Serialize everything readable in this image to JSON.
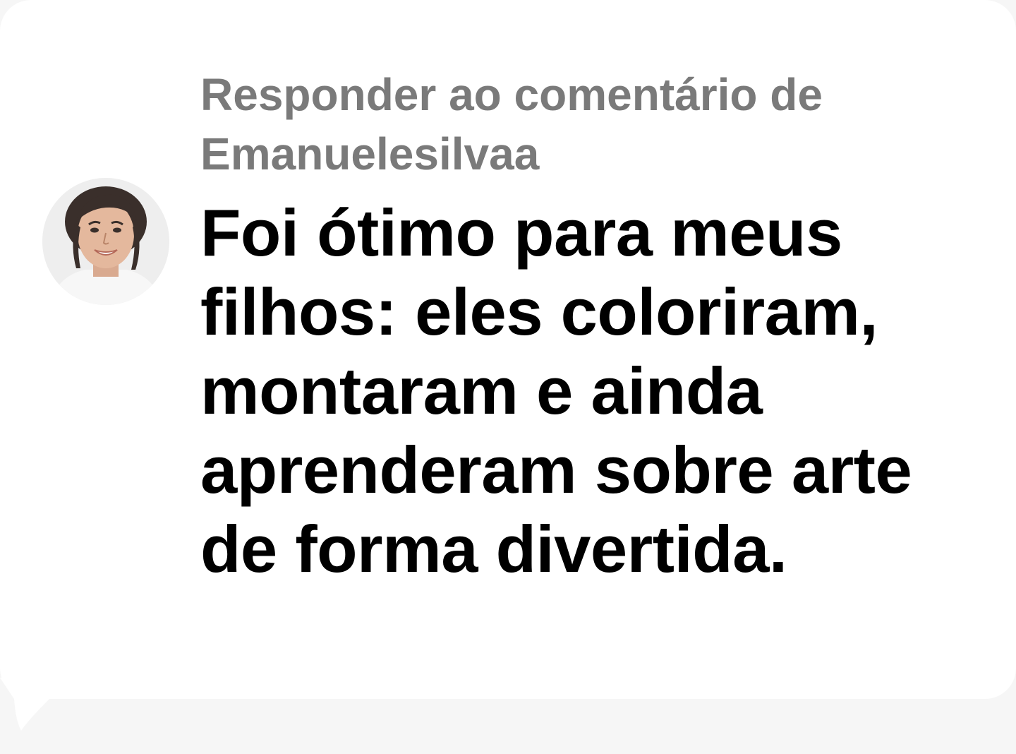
{
  "reply": {
    "header": "Responder ao comentário de Emanuelesilvaa",
    "comment_text": "Foi ótimo para meus filhos: eles coloriram, montaram e ainda aprenderam sobre arte de forma divertida."
  },
  "avatar": {
    "icon": "user-avatar-photo"
  },
  "colors": {
    "header_text": "#7a7a7a",
    "comment_text": "#000000",
    "bubble_background": "#ffffff",
    "page_background": "#f6f6f6"
  }
}
